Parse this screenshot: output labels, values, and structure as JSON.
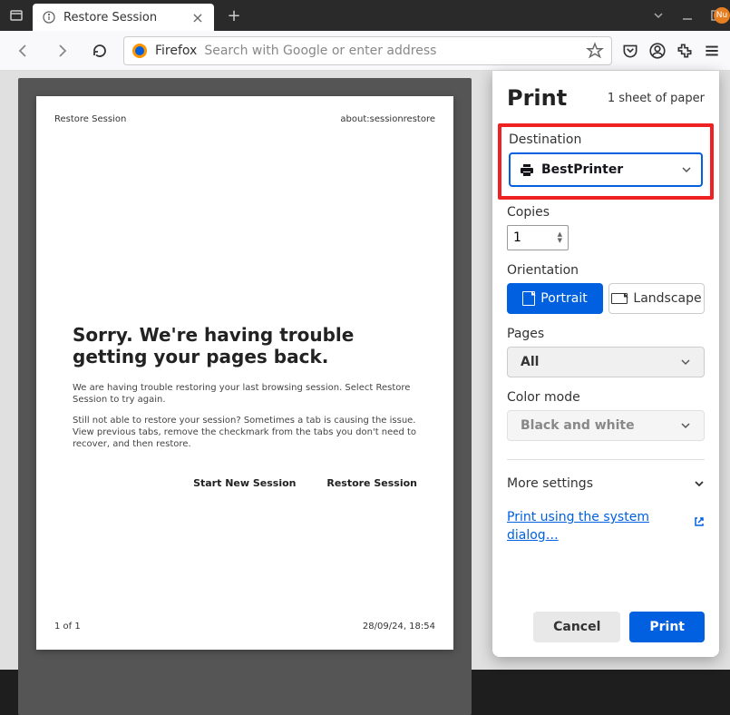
{
  "titlebar": {
    "tab_title": "Restore Session",
    "nu_text": "Nu"
  },
  "toolbar": {
    "brand": "Firefox",
    "search_placeholder": "Search with Google or enter address"
  },
  "preview": {
    "header_left": "Restore Session",
    "header_right": "about:sessionrestore",
    "h1": "Sorry. We're having trouble getting your pages back.",
    "p1": "We are having trouble restoring your last browsing session. Select Restore Session to try again.",
    "p2": "Still not able to restore your session? Sometimes a tab is causing the issue. View previous tabs, remove the checkmark from the tabs you don't need to recover, and then restore.",
    "action1": "Start New Session",
    "action2": "Restore Session",
    "footer_left": "1 of 1",
    "footer_right": "28/09/24, 18:54"
  },
  "print": {
    "title": "Print",
    "sheet_count": "1 sheet of paper",
    "destination_label": "Destination",
    "destination_value": "BestPrinter",
    "copies_label": "Copies",
    "copies_value": "1",
    "orientation_label": "Orientation",
    "portrait": "Portrait",
    "landscape": "Landscape",
    "pages_label": "Pages",
    "pages_value": "All",
    "color_label": "Color mode",
    "color_value": "Black and white",
    "more_settings": "More settings",
    "system_link": "Print using the system dialog…",
    "cancel": "Cancel",
    "print_btn": "Print"
  }
}
